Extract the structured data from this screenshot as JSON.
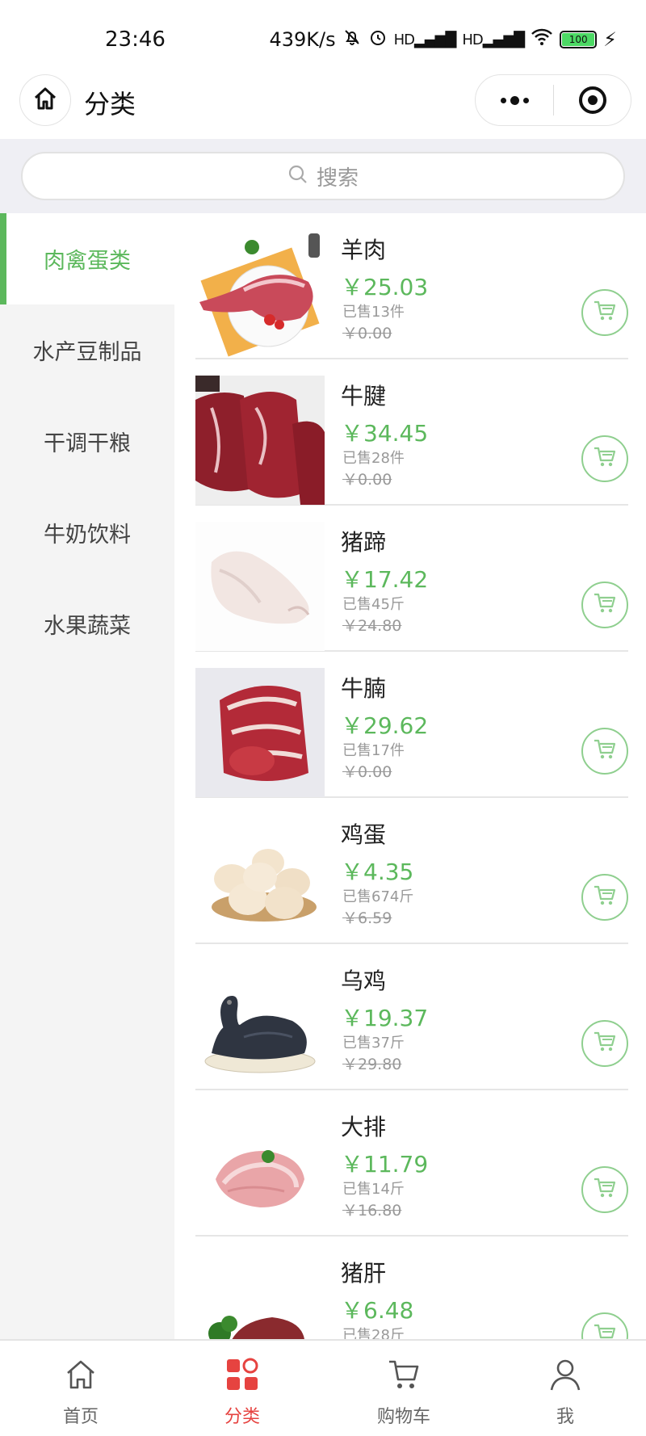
{
  "status_bar": {
    "time": "23:46",
    "network_speed": "439K/s",
    "hd1": "HD",
    "hd2": "HD",
    "battery": "100"
  },
  "header": {
    "title": "分类",
    "home_icon": "home-icon",
    "more_icon": "more-dots-icon",
    "close_icon": "target-close-icon"
  },
  "search": {
    "placeholder": "搜索"
  },
  "categories": [
    {
      "label": "肉禽蛋类",
      "active": true
    },
    {
      "label": "水产豆制品",
      "active": false
    },
    {
      "label": "干调干粮",
      "active": false
    },
    {
      "label": "牛奶饮料",
      "active": false
    },
    {
      "label": "水果蔬菜",
      "active": false
    }
  ],
  "products": [
    {
      "name": "羊肉",
      "price": "￥25.03",
      "sold": "已售13件",
      "original_price": "￥0.00"
    },
    {
      "name": "牛腱",
      "price": "￥34.45",
      "sold": "已售28件",
      "original_price": "￥0.00"
    },
    {
      "name": "猪蹄",
      "price": "￥17.42",
      "sold": "已售45斤",
      "original_price": "￥24.80"
    },
    {
      "name": "牛腩",
      "price": "￥29.62",
      "sold": "已售17件",
      "original_price": "￥0.00"
    },
    {
      "name": "鸡蛋",
      "price": "￥4.35",
      "sold": "已售674斤",
      "original_price": "￥6.59"
    },
    {
      "name": "乌鸡",
      "price": "￥19.37",
      "sold": "已售37斤",
      "original_price": "￥29.80"
    },
    {
      "name": "大排",
      "price": "￥11.79",
      "sold": "已售14斤",
      "original_price": "￥16.80"
    },
    {
      "name": "猪肝",
      "price": "￥6.48",
      "sold": "已售28斤",
      "original_price": ""
    }
  ],
  "tabbar": [
    {
      "label": "首页",
      "icon": "home-icon",
      "active": false
    },
    {
      "label": "分类",
      "icon": "category-icon",
      "active": true
    },
    {
      "label": "购物车",
      "icon": "cart-icon",
      "active": false
    },
    {
      "label": "我",
      "icon": "user-icon",
      "active": false
    }
  ],
  "colors": {
    "accent_green": "#5cb85c",
    "active_tab_red": "#e64340"
  }
}
